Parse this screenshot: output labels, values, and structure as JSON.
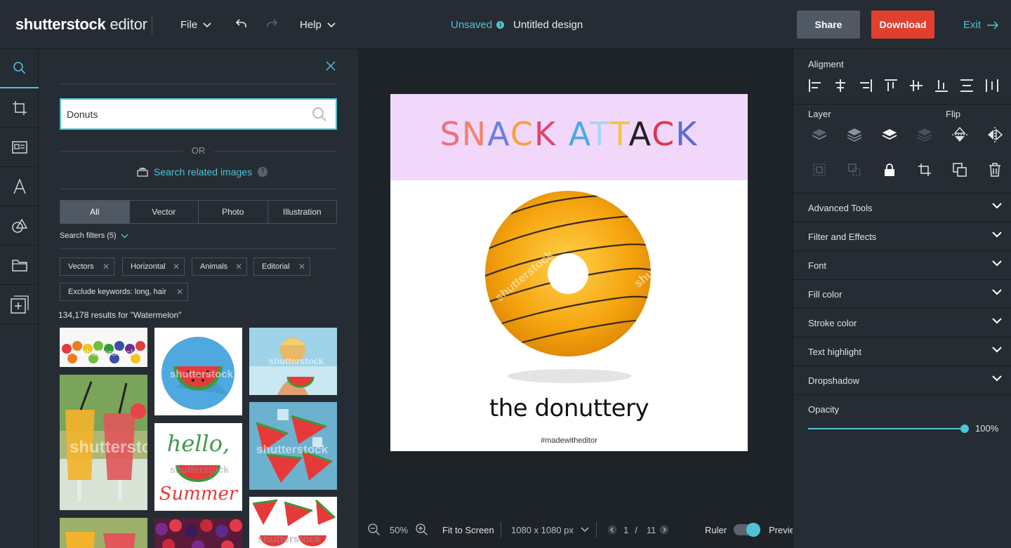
{
  "app": {
    "logo_brand": "shutterstock",
    "logo_product": "editor",
    "menu_file": "File",
    "menu_help": "Help",
    "status": "Unsaved",
    "document_title": "Untitled design",
    "share_label": "Share",
    "download_label": "Download",
    "exit_label": "Exit"
  },
  "colors": {
    "accent": "#4fc3d6",
    "download": "#e2402f",
    "share": "#4f5863",
    "banner": "#f1d8fb"
  },
  "rail": {
    "icons": [
      "search-icon",
      "crop-icon",
      "layout-icon",
      "text-icon",
      "shapes-icon",
      "folder-icon",
      "add-page-icon"
    ]
  },
  "search": {
    "value": "Donuts",
    "or_label": "OR",
    "related_label": "Search related images",
    "tabs": [
      "All",
      "Vector",
      "Photo",
      "Illustration"
    ],
    "active_tab": "All",
    "filters_label": "Search filters (5)",
    "chips": [
      "Vectors",
      "Horizontal",
      "Animals",
      "Editorial",
      "Exclude keywords: long, hair"
    ],
    "results_label": "134,178 results for \"Watermelon\"",
    "watermark": "shutterstock",
    "thumb_texts": {
      "hello": "hello,",
      "summer": "Summer"
    }
  },
  "artboard": {
    "headline_letters": [
      {
        "ch": "S",
        "color": "#f06d7e"
      },
      {
        "ch": "N",
        "color": "#f2836b"
      },
      {
        "ch": "A",
        "color": "#6b7fe0"
      },
      {
        "ch": "C",
        "color": "#f6a13c"
      },
      {
        "ch": "K",
        "color": "#e0456b"
      },
      {
        "ch": " ",
        "color": "#000000"
      },
      {
        "ch": "A",
        "color": "#4aa8e8"
      },
      {
        "ch": "T",
        "color": "#a8d4f0"
      },
      {
        "ch": "T",
        "color": "#f4c540"
      },
      {
        "ch": "A",
        "color": "#222222"
      },
      {
        "ch": "C",
        "color": "#e0344a"
      },
      {
        "ch": "K",
        "color": "#5a6bd8"
      }
    ],
    "tagline": "the donuttery",
    "hashtag": "#madewitheditor",
    "watermark": "shutterstock"
  },
  "bottombar": {
    "zoom": "50%",
    "fit_label": "Fit to Screen",
    "size_label": "1080 x 1080 px",
    "page_current": "1",
    "page_sep": "/",
    "page_total": "11",
    "ruler_label": "Ruler",
    "ruler_on": true,
    "preview_label": "Previe"
  },
  "properties": {
    "alignment_label": "Aligment",
    "layer_label": "Layer",
    "flip_label": "Flip",
    "sections": [
      "Advanced Tools",
      "Filter and Effects",
      "Font",
      "Fill color",
      "Stroke color",
      "Text highlight",
      "Dropshadow"
    ],
    "opacity_label": "Opacity",
    "opacity_value": "100%",
    "opacity_fraction": 1.0
  }
}
